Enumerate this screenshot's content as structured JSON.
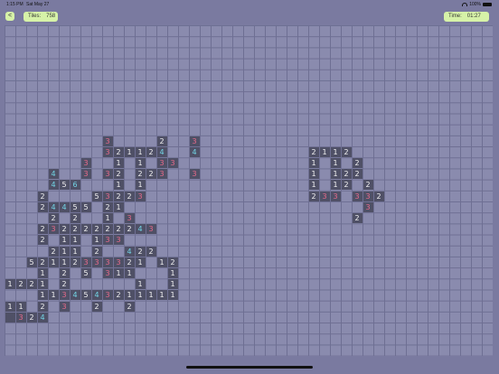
{
  "status": {
    "time": "1:15 PM",
    "date": "Sat May 27",
    "battery": "100%"
  },
  "header": {
    "back_label": "<",
    "tiles_label": "Tiles:",
    "tiles_value": "758",
    "time_label": "Time:",
    "time_value": "01:27"
  },
  "colors": {
    "1": "#f2f2f2",
    "2": "#f2f2f2",
    "3": "#e86a8a",
    "4": "#72d6e6",
    "5": "#f2f2f2",
    "6": "#72d6e6"
  },
  "board": {
    "cols": 45,
    "rows": 30,
    "revealed": [
      [
        9,
        10,
        "3"
      ],
      [
        14,
        10,
        "2"
      ],
      [
        17,
        10,
        "3"
      ],
      [
        9,
        11,
        "3"
      ],
      [
        10,
        11,
        "2"
      ],
      [
        11,
        11,
        "1"
      ],
      [
        12,
        11,
        "1"
      ],
      [
        13,
        11,
        "2"
      ],
      [
        14,
        11,
        "4"
      ],
      [
        17,
        11,
        "4"
      ],
      [
        7,
        12,
        "3"
      ],
      [
        10,
        12,
        "1"
      ],
      [
        12,
        12,
        "1"
      ],
      [
        14,
        12,
        "3"
      ],
      [
        15,
        12,
        "3"
      ],
      [
        4,
        13,
        "4"
      ],
      [
        7,
        13,
        "3"
      ],
      [
        9,
        13,
        "3"
      ],
      [
        10,
        13,
        "2"
      ],
      [
        12,
        13,
        "2"
      ],
      [
        13,
        13,
        "2"
      ],
      [
        14,
        13,
        "3"
      ],
      [
        17,
        13,
        "3"
      ],
      [
        4,
        14,
        "4"
      ],
      [
        5,
        14,
        "5"
      ],
      [
        6,
        14,
        "6"
      ],
      [
        10,
        14,
        "1"
      ],
      [
        12,
        14,
        "1"
      ],
      [
        3,
        15,
        "2"
      ],
      [
        8,
        15,
        "5"
      ],
      [
        9,
        15,
        "3"
      ],
      [
        10,
        15,
        "2"
      ],
      [
        11,
        15,
        "2"
      ],
      [
        12,
        15,
        "3"
      ],
      [
        3,
        16,
        "2"
      ],
      [
        4,
        16,
        "4"
      ],
      [
        5,
        16,
        "4"
      ],
      [
        6,
        16,
        "5"
      ],
      [
        7,
        16,
        "5"
      ],
      [
        9,
        16,
        "2"
      ],
      [
        10,
        16,
        "1"
      ],
      [
        4,
        17,
        "2"
      ],
      [
        6,
        17,
        "2"
      ],
      [
        9,
        17,
        "1"
      ],
      [
        11,
        17,
        "3"
      ],
      [
        3,
        18,
        "2"
      ],
      [
        4,
        18,
        "3"
      ],
      [
        5,
        18,
        "2"
      ],
      [
        6,
        18,
        "2"
      ],
      [
        7,
        18,
        "2"
      ],
      [
        8,
        18,
        "2"
      ],
      [
        9,
        18,
        "2"
      ],
      [
        10,
        18,
        "2"
      ],
      [
        11,
        18,
        "2"
      ],
      [
        12,
        18,
        "4"
      ],
      [
        13,
        18,
        "3"
      ],
      [
        3,
        19,
        "2"
      ],
      [
        5,
        19,
        "1"
      ],
      [
        6,
        19,
        "1"
      ],
      [
        8,
        19,
        "1"
      ],
      [
        9,
        19,
        "3"
      ],
      [
        10,
        19,
        "3"
      ],
      [
        4,
        20,
        "2"
      ],
      [
        5,
        20,
        "1"
      ],
      [
        6,
        20,
        "1"
      ],
      [
        8,
        20,
        "2"
      ],
      [
        11,
        20,
        "4"
      ],
      [
        12,
        20,
        "2"
      ],
      [
        13,
        20,
        "2"
      ],
      [
        2,
        21,
        "5"
      ],
      [
        3,
        21,
        "2"
      ],
      [
        4,
        21,
        "1"
      ],
      [
        5,
        21,
        "1"
      ],
      [
        6,
        21,
        "2"
      ],
      [
        7,
        21,
        "3"
      ],
      [
        8,
        21,
        "3"
      ],
      [
        9,
        21,
        "3"
      ],
      [
        10,
        21,
        "3"
      ],
      [
        11,
        21,
        "2"
      ],
      [
        12,
        21,
        "1"
      ],
      [
        14,
        21,
        "1"
      ],
      [
        15,
        21,
        "2"
      ],
      [
        3,
        22,
        "1"
      ],
      [
        5,
        22,
        "2"
      ],
      [
        7,
        22,
        "5"
      ],
      [
        9,
        22,
        "3"
      ],
      [
        10,
        22,
        "1"
      ],
      [
        11,
        22,
        "1"
      ],
      [
        15,
        22,
        "1"
      ],
      [
        0,
        23,
        "1"
      ],
      [
        1,
        23,
        "2"
      ],
      [
        2,
        23,
        "2"
      ],
      [
        3,
        23,
        "1"
      ],
      [
        5,
        23,
        "2"
      ],
      [
        12,
        23,
        "1"
      ],
      [
        15,
        23,
        "1"
      ],
      [
        3,
        24,
        "1"
      ],
      [
        4,
        24,
        "1"
      ],
      [
        5,
        24,
        "3"
      ],
      [
        6,
        24,
        "4"
      ],
      [
        7,
        24,
        "5"
      ],
      [
        8,
        24,
        "4"
      ],
      [
        9,
        24,
        "3"
      ],
      [
        10,
        24,
        "2"
      ],
      [
        11,
        24,
        "1"
      ],
      [
        12,
        24,
        "1"
      ],
      [
        13,
        24,
        "1"
      ],
      [
        14,
        24,
        "1"
      ],
      [
        15,
        24,
        "1"
      ],
      [
        0,
        25,
        "1"
      ],
      [
        1,
        25,
        "1"
      ],
      [
        3,
        25,
        "2"
      ],
      [
        5,
        25,
        "3"
      ],
      [
        8,
        25,
        "2"
      ],
      [
        11,
        25,
        "2"
      ],
      [
        0,
        26,
        ""
      ],
      [
        1,
        26,
        "3"
      ],
      [
        2,
        26,
        "2"
      ],
      [
        3,
        26,
        "4"
      ],
      [
        28,
        11,
        "2"
      ],
      [
        29,
        11,
        "1"
      ],
      [
        30,
        11,
        "1"
      ],
      [
        31,
        11,
        "2"
      ],
      [
        28,
        12,
        "1"
      ],
      [
        30,
        12,
        "1"
      ],
      [
        32,
        12,
        "2"
      ],
      [
        28,
        13,
        "1"
      ],
      [
        30,
        13,
        "1"
      ],
      [
        31,
        13,
        "2"
      ],
      [
        32,
        13,
        "2"
      ],
      [
        28,
        14,
        "1"
      ],
      [
        30,
        14,
        "1"
      ],
      [
        31,
        14,
        "2"
      ],
      [
        33,
        14,
        "2"
      ],
      [
        28,
        15,
        "2"
      ],
      [
        29,
        15,
        "3"
      ],
      [
        30,
        15,
        "3"
      ],
      [
        32,
        15,
        "3"
      ],
      [
        33,
        15,
        "3"
      ],
      [
        34,
        15,
        "2"
      ],
      [
        33,
        16,
        "3"
      ],
      [
        32,
        17,
        "2"
      ]
    ]
  }
}
